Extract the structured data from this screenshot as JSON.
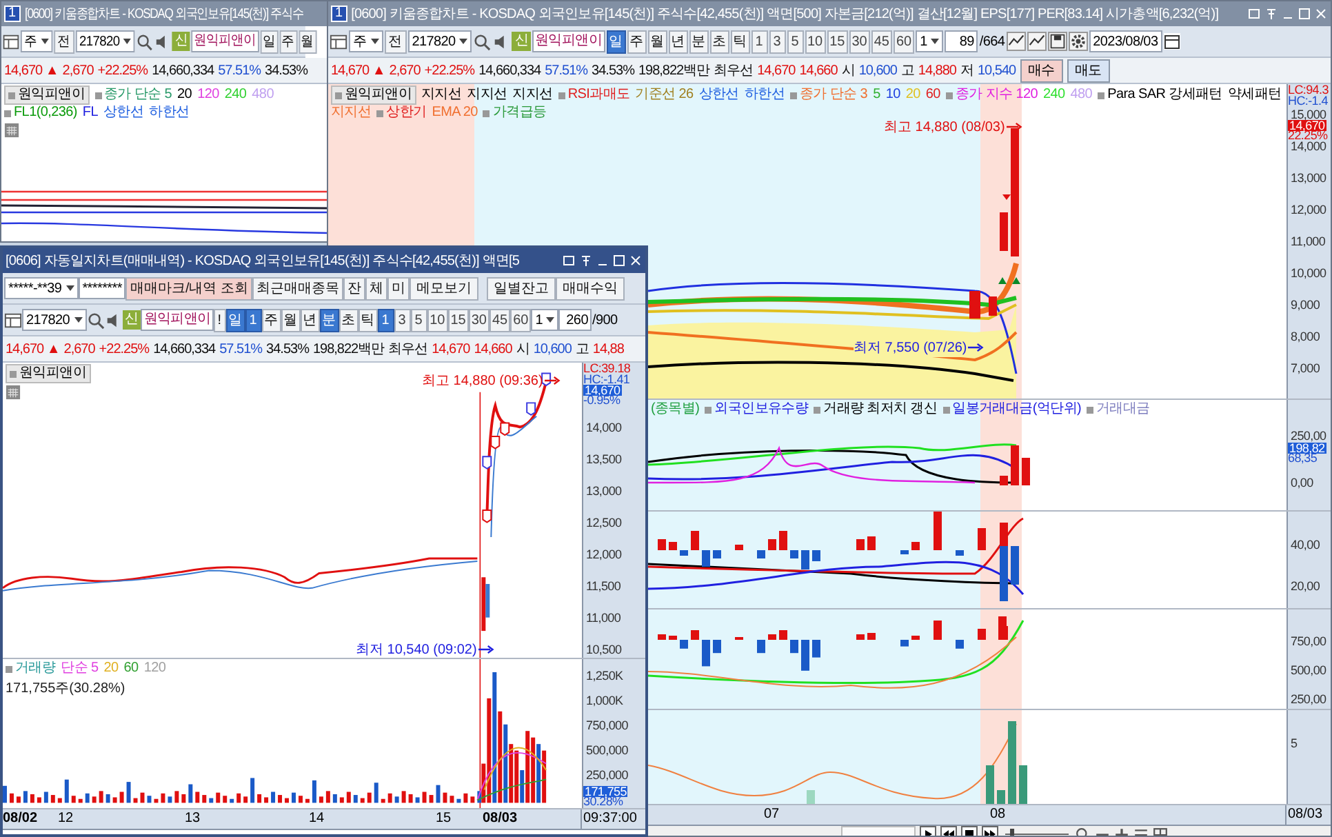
{
  "windows": [
    {
      "kind": "back",
      "number": "1",
      "title": "[0600] 키움종합차트 - KOSDAQ 외국인보유[145(천)] 주식수",
      "active": false,
      "toolbars": [
        [
          {
            "kind": "layout"
          },
          {
            "kind": "combo",
            "text": "주"
          },
          {
            "kind": "btn",
            "text": "전"
          },
          {
            "kind": "field",
            "text": "217820"
          },
          {
            "kind": "search"
          },
          {
            "kind": "speaker"
          },
          {
            "kind": "badge",
            "text": "신"
          },
          {
            "kind": "name",
            "text": "원익피앤이"
          },
          {
            "kind": "tab",
            "text": "일",
            "selected": false
          },
          {
            "kind": "tab",
            "text": "주",
            "selected": false
          },
          {
            "kind": "tab",
            "text": "월",
            "selected": false
          }
        ]
      ],
      "quote": [
        {
          "kind": "up",
          "text": "14,670 ▲"
        },
        {
          "kind": "up",
          "text": "2,670"
        },
        {
          "kind": "up",
          "text": "+22.25%"
        },
        {
          "kind": "plain",
          "text": "14,660,334"
        },
        {
          "kind": "down",
          "text": "57.51%"
        },
        {
          "kind": "plain",
          "text": "34.53%"
        }
      ],
      "panes": [
        {
          "legend": [
            {
              "text": "원익피앤이",
              "color": "#000000",
              "marker": true,
              "boxed": true
            },
            {
              "text": "종가 단순 5",
              "color": "#2a9a6a",
              "marker": true,
              "boxed": false
            },
            {
              "text": "20",
              "color": "#000000",
              "marker": false,
              "boxed": false
            },
            {
              "text": "120",
              "color": "#e040e0",
              "marker": false,
              "boxed": false
            },
            {
              "text": "240",
              "color": "#30d030",
              "marker": false,
              "boxed": false
            },
            {
              "text": "480",
              "color": "#c0a0f0",
              "marker": false,
              "boxed": false
            },
            {
              "text": "FL1(0,236)",
              "color": "#0a9a0a",
              "marker": true,
              "boxed": false
            },
            {
              "text": "FL",
              "color": "#2020e0",
              "marker": false,
              "boxed": false
            },
            {
              "text": "상한선",
              "color": "#2060e0",
              "marker": false,
              "boxed": false
            },
            {
              "text": "하한선",
              "color": "#2060e0",
              "marker": false,
              "boxed": false
            }
          ]
        }
      ]
    },
    {
      "kind": "main",
      "number": "1",
      "title": "[0600] 키움종합차트 - KOSDAQ 외국인보유[145(천)] 주식수[42,455(천)] 액면[500] 자본금[212(억)] 결산[12월] EPS[177] PER[83.14] 시가총액[6,232(억)]",
      "active": false,
      "toolbars": [
        [
          {
            "kind": "layout"
          },
          {
            "kind": "combo",
            "text": "주"
          },
          {
            "kind": "btn",
            "text": "전"
          },
          {
            "kind": "field",
            "text": "217820"
          },
          {
            "kind": "search"
          },
          {
            "kind": "speaker"
          },
          {
            "kind": "badge",
            "text": "신"
          },
          {
            "kind": "name",
            "text": "원익피앤이"
          },
          {
            "kind": "tab",
            "text": "일",
            "selected": true
          },
          {
            "kind": "tab",
            "text": "주",
            "selected": false
          },
          {
            "kind": "tab",
            "text": "월",
            "selected": false
          },
          {
            "kind": "tab",
            "text": "년",
            "selected": false
          },
          {
            "kind": "tab",
            "text": "분",
            "selected": false
          },
          {
            "kind": "tab",
            "text": "초",
            "selected": false
          },
          {
            "kind": "tab",
            "text": "틱",
            "selected": false
          },
          {
            "kind": "num",
            "text": "1",
            "selected": false
          },
          {
            "kind": "num",
            "text": "3",
            "selected": false
          },
          {
            "kind": "num",
            "text": "5",
            "selected": false
          },
          {
            "kind": "num",
            "text": "10",
            "selected": false
          },
          {
            "kind": "num",
            "text": "15",
            "selected": false
          },
          {
            "kind": "num",
            "text": "30",
            "selected": false
          },
          {
            "kind": "num",
            "text": "45",
            "selected": false
          },
          {
            "kind": "num",
            "text": "60",
            "selected": false
          },
          {
            "kind": "combo",
            "text": "1"
          },
          {
            "kind": "count",
            "text": "89"
          },
          {
            "kind": "label",
            "text": "/664"
          },
          {
            "kind": "tool"
          },
          {
            "kind": "tool"
          },
          {
            "kind": "save"
          },
          {
            "kind": "gear"
          },
          {
            "kind": "date",
            "text": "2023/08/03"
          }
        ]
      ],
      "quote": [
        {
          "kind": "up",
          "text": "14,670 ▲"
        },
        {
          "kind": "up",
          "text": "2,670"
        },
        {
          "kind": "up",
          "text": "+22.25%"
        },
        {
          "kind": "plain",
          "text": "14,660,334"
        },
        {
          "kind": "down",
          "text": "57.51%"
        },
        {
          "kind": "plain",
          "text": "34.53%"
        },
        {
          "kind": "plain",
          "text": "198,822백만"
        },
        {
          "kind": "plain",
          "text": "최우선"
        },
        {
          "kind": "up",
          "text": "14,670"
        },
        {
          "kind": "up",
          "text": "14,660"
        },
        {
          "kind": "plain",
          "text": "시"
        },
        {
          "kind": "down",
          "text": "10,600"
        },
        {
          "kind": "plain",
          "text": "고"
        },
        {
          "kind": "up",
          "text": "14,880"
        },
        {
          "kind": "plain",
          "text": "저"
        },
        {
          "kind": "down",
          "text": "10,540"
        },
        {
          "kind": "buy",
          "text": "매수"
        },
        {
          "kind": "sell",
          "text": "매도"
        }
      ],
      "panes": [
        {
          "legend": [
            {
              "text": "원익피앤이",
              "color": "#000000",
              "marker": true,
              "boxed": true
            },
            {
              "text": "지지선",
              "color": "#000000",
              "marker": false,
              "boxed": false
            },
            {
              "text": "지지선",
              "color": "#000000",
              "marker": false,
              "boxed": false
            },
            {
              "text": "지지선",
              "color": "#000000",
              "marker": false,
              "boxed": false
            },
            {
              "text": "RSI과매도",
              "color": "#e02020",
              "marker": true,
              "boxed": false
            },
            {
              "text": "기준선 26",
              "color": "#a08020",
              "marker": false,
              "boxed": false
            },
            {
              "text": "상한선",
              "color": "#2060e0",
              "marker": false,
              "boxed": false
            },
            {
              "text": "하한선",
              "color": "#2060e0",
              "marker": false,
              "boxed": false
            },
            {
              "text": "종가 단순 3",
              "color": "#f07030",
              "marker": true,
              "boxed": false
            },
            {
              "text": "5",
              "color": "#30b030",
              "marker": false,
              "boxed": false
            },
            {
              "text": "10",
              "color": "#2040e0",
              "marker": false,
              "boxed": false
            },
            {
              "text": "20",
              "color": "#e0c020",
              "marker": false,
              "boxed": false
            },
            {
              "text": "60",
              "color": "#e02020",
              "marker": false,
              "boxed": false
            },
            {
              "text": "종가 지수 120",
              "color": "#e020e0",
              "marker": true,
              "boxed": false
            },
            {
              "text": "240",
              "color": "#30e030",
              "marker": false,
              "boxed": false
            },
            {
              "text": "480",
              "color": "#c0a0f0",
              "marker": false,
              "boxed": false
            },
            {
              "text": "Para SAR 강세패턴",
              "color": "#000000",
              "marker": true,
              "boxed": false
            },
            {
              "text": "약세패턴",
              "color": "#000000",
              "marker": false,
              "boxed": false
            },
            {
              "text": "지지선",
              "color": "#f07030",
              "marker": false,
              "boxed": false
            },
            {
              "text": "상한기",
              "color": "#e02020",
              "marker": true,
              "boxed": false
            },
            {
              "text": "EMA 20",
              "color": "#f07030",
              "marker": false,
              "boxed": false
            },
            {
              "text": "가격급등",
              "color": "#2a9a3a",
              "marker": true,
              "boxed": false
            }
          ],
          "notes": [
            {
              "kind": "high",
              "text": "최고 14,880 (08/03)"
            },
            {
              "kind": "low",
              "text": "최저 7,550 (07/26)"
            }
          ],
          "axis": [
            {
              "kind": "head-up",
              "text": "LC:94.3"
            },
            {
              "kind": "head-down",
              "text": "HC:-1.4"
            },
            {
              "kind": "tick",
              "text": "15,000"
            },
            {
              "kind": "tag-up",
              "text": "14,670"
            },
            {
              "kind": "note-up",
              "text": "22.25%"
            },
            {
              "kind": "tick",
              "text": "14,000"
            },
            {
              "kind": "tick",
              "text": "13,000"
            },
            {
              "kind": "tick",
              "text": "12,000"
            },
            {
              "kind": "tick",
              "text": "11,000"
            },
            {
              "kind": "tick",
              "text": "10,000"
            },
            {
              "kind": "tick",
              "text": "9,000"
            },
            {
              "kind": "tick",
              "text": "8,000"
            },
            {
              "kind": "tick",
              "text": "7,000"
            }
          ]
        },
        {
          "legend": [
            {
              "text": "(종목별)",
              "color": "#20a040",
              "marker": false,
              "boxed": false
            },
            {
              "text": "외국인보유수량",
              "color": "#2020e0",
              "marker": true,
              "boxed": false
            },
            {
              "text": "거래량 최저치 갱신",
              "color": "#000000",
              "marker": true,
              "boxed": false
            },
            {
              "text": "일봉거래대금(억단위)",
              "color": "#2020e0",
              "marker": true,
              "boxed": false
            },
            {
              "text": "거래대금",
              "color": "#8080c0",
              "marker": true,
              "boxed": false
            }
          ],
          "axis": [
            {
              "kind": "tick",
              "text": "250,00"
            },
            {
              "kind": "tag-down",
              "text": "198,82"
            },
            {
              "kind": "note-down",
              "text": "68,35"
            },
            {
              "kind": "tick",
              "text": "0,00"
            }
          ]
        },
        {
          "axis": [
            {
              "kind": "tick",
              "text": "40,00"
            },
            {
              "kind": "tick",
              "text": "20,00"
            }
          ]
        },
        {
          "axis": [
            {
              "kind": "tick",
              "text": "750,00"
            },
            {
              "kind": "tick",
              "text": "500,00"
            },
            {
              "kind": "tick",
              "text": "250,00"
            }
          ]
        },
        {
          "axis": [
            {
              "kind": "tick",
              "text": "5"
            }
          ]
        }
      ],
      "xaxis": [
        "07",
        "08"
      ],
      "xcorner": "08/03",
      "zoom_slider": {
        "level": 0.08
      }
    },
    {
      "kind": "front",
      "title": "[0606] 자동일지차트(매매내역) - KOSDAQ 외국인보유[145(천)] 주식수[42,455(천)] 액면[5",
      "active": true,
      "toolbars": [
        [
          {
            "kind": "field",
            "text": "*****-**39"
          },
          {
            "kind": "pw",
            "text": "********"
          },
          {
            "kind": "action",
            "text": "매매마크/내역 조회"
          },
          {
            "kind": "btn",
            "text": "최근매매종목"
          },
          {
            "kind": "btn",
            "text": "잔"
          },
          {
            "kind": "btn",
            "text": "체"
          },
          {
            "kind": "btn",
            "text": "미"
          },
          {
            "kind": "wide",
            "text": "메모보기"
          },
          {
            "kind": "gap"
          },
          {
            "kind": "wide",
            "text": "일별잔고"
          },
          {
            "kind": "wide",
            "text": "매매수익"
          }
        ],
        [
          {
            "kind": "layout"
          },
          {
            "kind": "field",
            "text": "217820"
          },
          {
            "kind": "search"
          },
          {
            "kind": "speaker"
          },
          {
            "kind": "badge",
            "text": "신"
          },
          {
            "kind": "name",
            "text": "원익피앤이"
          },
          {
            "kind": "btn",
            "text": "!"
          },
          {
            "kind": "tab",
            "text": "일",
            "selected": true
          },
          {
            "kind": "num",
            "text": "1",
            "selected": true
          },
          {
            "kind": "tab",
            "text": "주",
            "selected": false
          },
          {
            "kind": "tab",
            "text": "월",
            "selected": false
          },
          {
            "kind": "tab",
            "text": "년",
            "selected": false
          },
          {
            "kind": "tab",
            "text": "분",
            "selected": true
          },
          {
            "kind": "tab",
            "text": "초",
            "selected": false
          },
          {
            "kind": "tab",
            "text": "틱",
            "selected": false
          },
          {
            "kind": "num",
            "text": "1",
            "selected": true
          },
          {
            "kind": "num",
            "text": "3",
            "selected": false
          },
          {
            "kind": "num",
            "text": "5",
            "selected": false
          },
          {
            "kind": "num",
            "text": "10",
            "selected": false
          },
          {
            "kind": "num",
            "text": "15",
            "selected": false
          },
          {
            "kind": "num",
            "text": "30",
            "selected": false
          },
          {
            "kind": "num",
            "text": "45",
            "selected": false
          },
          {
            "kind": "num",
            "text": "60",
            "selected": false
          },
          {
            "kind": "combo",
            "text": "1"
          },
          {
            "kind": "count",
            "text": "260"
          },
          {
            "kind": "label",
            "text": "/900"
          }
        ]
      ],
      "quote": [
        {
          "kind": "up",
          "text": "14,670 ▲"
        },
        {
          "kind": "up",
          "text": "2,670"
        },
        {
          "kind": "up",
          "text": "+22.25%"
        },
        {
          "kind": "plain",
          "text": "14,660,334"
        },
        {
          "kind": "down",
          "text": "57.51%"
        },
        {
          "kind": "plain",
          "text": "34.53%"
        },
        {
          "kind": "plain",
          "text": "198,822백만"
        },
        {
          "kind": "plain",
          "text": "최우선"
        },
        {
          "kind": "up",
          "text": "14,670"
        },
        {
          "kind": "up",
          "text": "14,660"
        },
        {
          "kind": "plain",
          "text": "시"
        },
        {
          "kind": "down",
          "text": "10,600"
        },
        {
          "kind": "plain",
          "text": "고"
        },
        {
          "kind": "up",
          "text": "14,88"
        }
      ],
      "panes": [
        {
          "legend": [
            {
              "text": "원익피앤이",
              "color": "#000000",
              "marker": true,
              "boxed": true
            }
          ],
          "notes": [
            {
              "kind": "high",
              "text": "최고 14,880 (09:36)"
            },
            {
              "kind": "low",
              "text": "최저 10,540 (09:02)"
            }
          ],
          "axis": [
            {
              "kind": "head-up",
              "text": "LC:39.18"
            },
            {
              "kind": "head-down",
              "text": "HC:-1.41"
            },
            {
              "kind": "tag-down",
              "text": "14,670"
            },
            {
              "kind": "note-down",
              "text": "-0.95%"
            },
            {
              "kind": "tick",
              "text": "14,000"
            },
            {
              "kind": "tick",
              "text": "13,500"
            },
            {
              "kind": "tick",
              "text": "13,000"
            },
            {
              "kind": "tick",
              "text": "12,500"
            },
            {
              "kind": "tick",
              "text": "12,000"
            },
            {
              "kind": "tick",
              "text": "11,500"
            },
            {
              "kind": "tick",
              "text": "11,000"
            },
            {
              "kind": "tick",
              "text": "10,500"
            }
          ]
        },
        {
          "legend": [
            {
              "text": "거래량",
              "color": "#2a9a9a",
              "marker": true,
              "boxed": false
            },
            {
              "text": "단순 5",
              "color": "#e040e0",
              "marker": false,
              "boxed": false
            },
            {
              "text": "20",
              "color": "#e0b020",
              "marker": false,
              "boxed": false
            },
            {
              "text": "60",
              "color": "#30a030",
              "marker": false,
              "boxed": false
            },
            {
              "text": "120",
              "color": "#a0a0a0",
              "marker": false,
              "boxed": false
            }
          ],
          "sub": "171,755주(30.28%)",
          "axis": [
            {
              "kind": "tick",
              "text": "1,250K"
            },
            {
              "kind": "tick",
              "text": "1,000K"
            },
            {
              "kind": "tick",
              "text": "750,000"
            },
            {
              "kind": "tick",
              "text": "500,000"
            },
            {
              "kind": "tick",
              "text": "250,000"
            },
            {
              "kind": "tag-down",
              "text": "171,755"
            },
            {
              "kind": "note-down",
              "text": "30.28%"
            }
          ]
        }
      ],
      "xaxis": [
        "08/02",
        "12",
        "13",
        "14",
        "15",
        "08/03"
      ],
      "xcorner": "09:37:00"
    }
  ]
}
